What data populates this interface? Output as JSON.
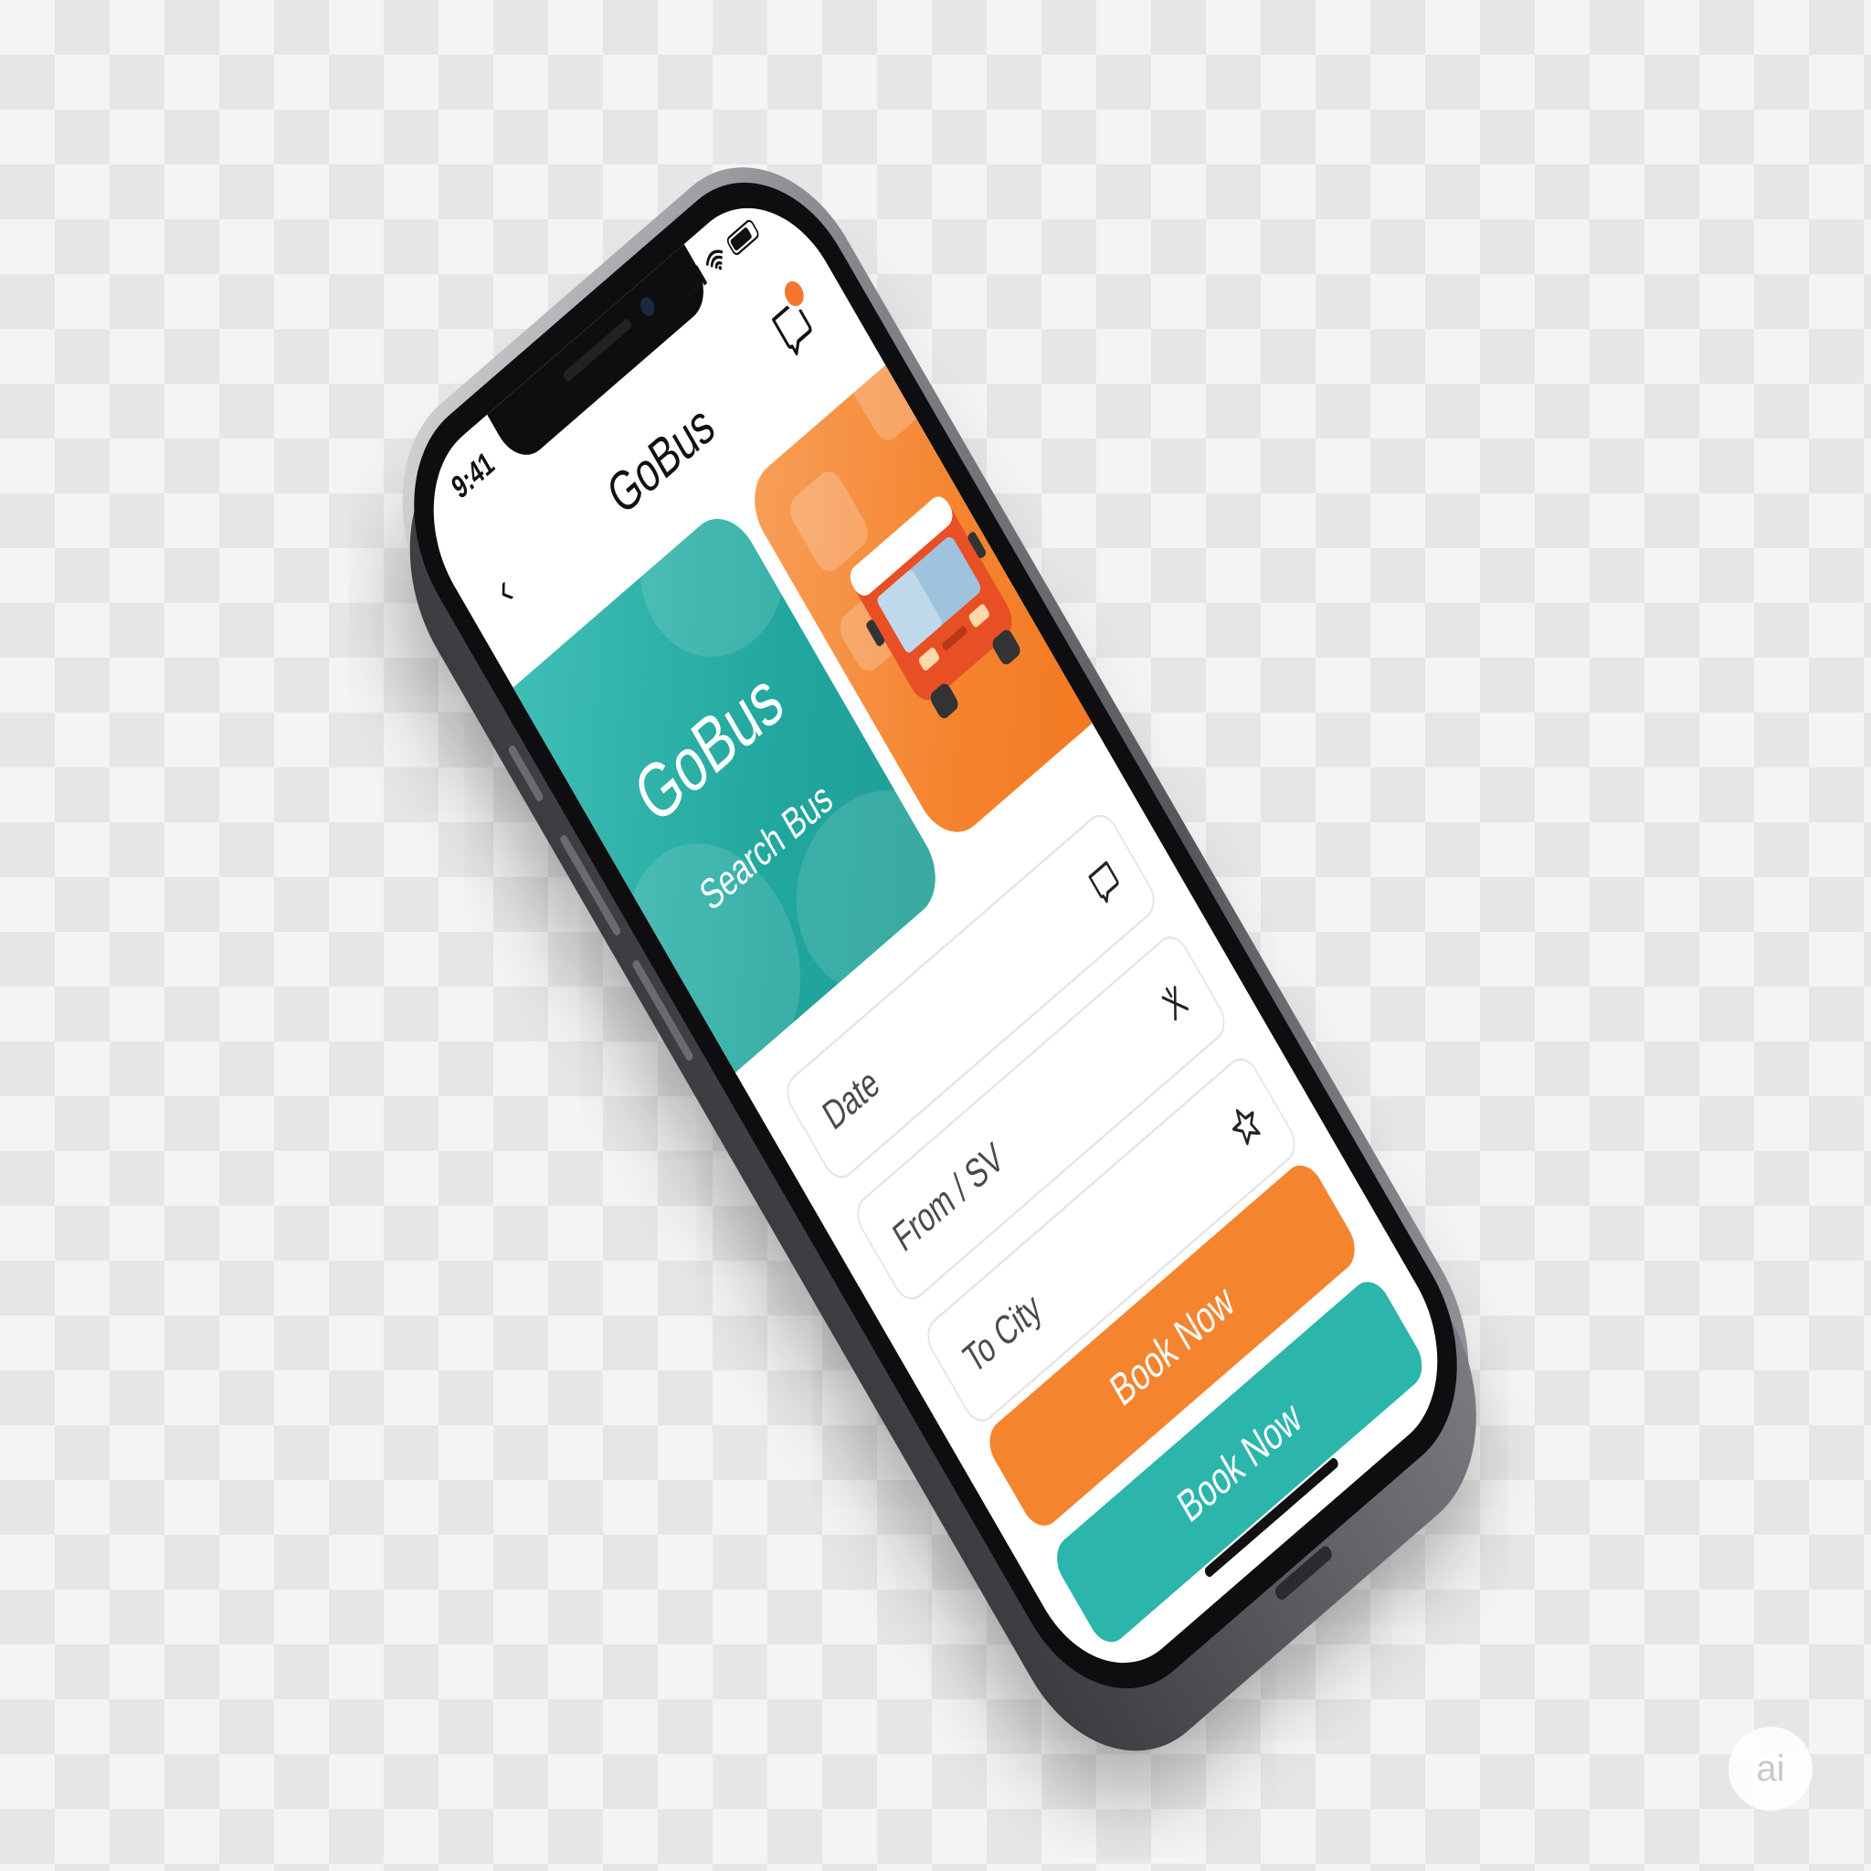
{
  "status_bar": {
    "time": "9:41"
  },
  "header": {
    "title": "GoBus",
    "back_icon": "chevron-left-icon",
    "action_icon": "bookmark-icon"
  },
  "hero": {
    "teal_card": {
      "title": "GoBus",
      "subtitle": "Search Bus"
    },
    "orange_card": {
      "illustration": "bus-icon"
    }
  },
  "form": {
    "fields": [
      {
        "label": "Date",
        "icon": "bookmark-icon"
      },
      {
        "label": "From / SV",
        "icon": "swap-icon"
      },
      {
        "label": "To City",
        "icon": "star-icon"
      }
    ]
  },
  "buttons": {
    "primary_label": "Book Now",
    "secondary_label": "Book Now"
  },
  "watermark": {
    "text": "ai"
  },
  "colors": {
    "teal": "#2bb5ab",
    "orange": "#f5842f",
    "text": "#111111"
  }
}
